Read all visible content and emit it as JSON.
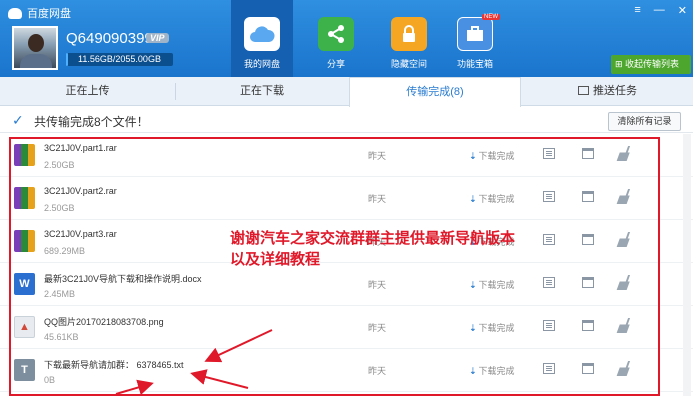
{
  "app": {
    "title": "百度网盘"
  },
  "user": {
    "name": "Q649090399",
    "vip": "VIP",
    "quota_text": "11.56GB/2055.00GB",
    "quota_fraction": 0.0056
  },
  "nav": [
    {
      "label": "我的网盘",
      "icon": "cloud-icon",
      "color": "#5aa8ef"
    },
    {
      "label": "分享",
      "icon": "share-icon",
      "color": "#3db14a"
    },
    {
      "label": "隐藏空间",
      "icon": "lock-icon",
      "color": "#f5a623"
    },
    {
      "label": "功能宝箱",
      "icon": "toolbox-icon",
      "color": "#4a90e2",
      "badge": "NEW"
    }
  ],
  "collapse_label": "收起传输列表",
  "subtabs": [
    "正在上传",
    "正在下载",
    "传输完成(8)",
    "推送任务"
  ],
  "summary": {
    "text": "共传输完成8个文件！",
    "clear_label": "清除所有记录"
  },
  "files": [
    {
      "name": "3C21J0V.part1.rar",
      "size": "2.50GB",
      "date": "昨天",
      "status": "下载完成",
      "type": "rar"
    },
    {
      "name": "3C21J0V.part2.rar",
      "size": "2.50GB",
      "date": "昨天",
      "status": "下载完成",
      "type": "rar"
    },
    {
      "name": "3C21J0V.part3.rar",
      "size": "689.29MB",
      "date": "昨天",
      "status": "下载完成",
      "type": "rar"
    },
    {
      "name": "最新3C21J0V导航下载和操作说明.docx",
      "size": "2.45MB",
      "date": "昨天",
      "status": "下载完成",
      "type": "doc"
    },
    {
      "name": "QQ图片20170218083708.png",
      "size": "45.61KB",
      "date": "昨天",
      "status": "下载完成",
      "type": "img"
    },
    {
      "name": "下载最新导航请加群： 6378465.txt",
      "size": "0B",
      "date": "昨天",
      "status": "下载完成",
      "type": "txt"
    }
  ],
  "annotation": {
    "line1": "谢谢汽车之家交流群群主提供最新导航版本",
    "line2": "以及详细教程"
  }
}
